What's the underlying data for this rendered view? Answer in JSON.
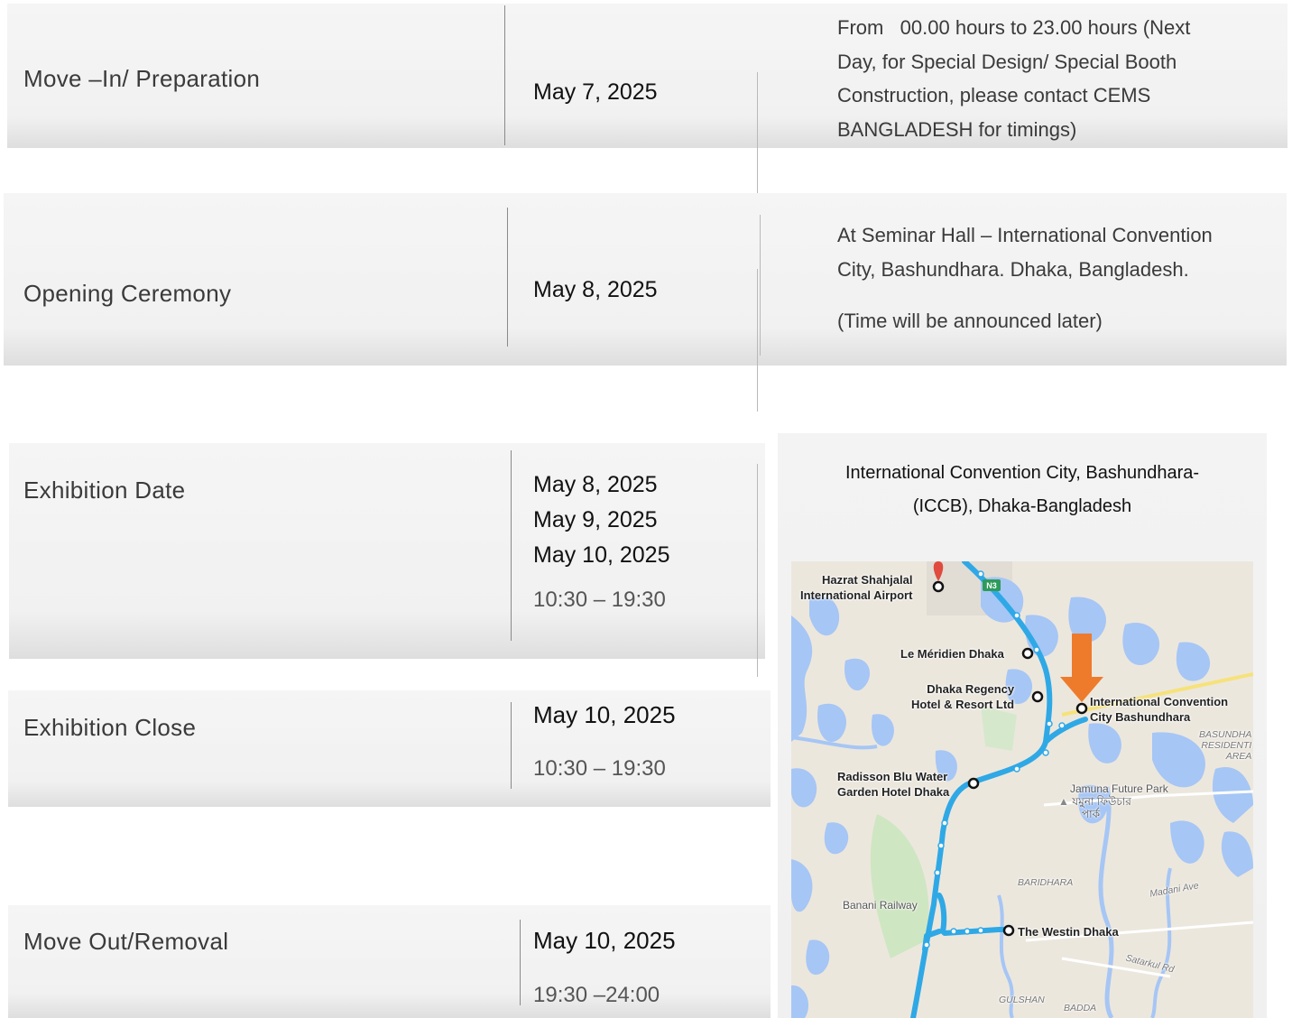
{
  "schedule": [
    {
      "label": "Move –In/ Preparation",
      "dates": [
        "May 7, 2025"
      ],
      "info_lines": [
        "From   00.00 hours to 23.00 hours (Next",
        "Day, for Special Design/ Special Booth",
        "Construction, please contact CEMS",
        "BANGLADESH for timings)"
      ]
    },
    {
      "label": "Opening Ceremony",
      "dates": [
        "May 8, 2025"
      ],
      "info_lines": [
        "At Seminar Hall – International Convention",
        "City, Bashundhara. Dhaka, Bangladesh."
      ],
      "info_note": "(Time will be announced later)"
    },
    {
      "label": "Exhibition Date",
      "dates": [
        "May 8, 2025",
        "May 9, 2025",
        "May 10, 2025"
      ],
      "time": "10:30 – 19:30"
    },
    {
      "label": "Exhibition Close",
      "dates": [
        "May 10, 2025"
      ],
      "time": "10:30 – 19:30"
    },
    {
      "label": "Move Out/Removal",
      "dates": [
        "May 10, 2025"
      ],
      "time": "19:30 –24:00"
    }
  ],
  "venue": {
    "title_line1": "International Convention City, Bashundhara-",
    "title_line2": "(ICCB), Dhaka-Bangladesh"
  },
  "map": {
    "labels": {
      "airport": [
        "Hazrat Shahjalal",
        "International Airport"
      ],
      "meridien": "Le Méridien Dhaka",
      "regency": [
        "Dhaka Regency",
        "Hotel & Resort Ltd"
      ],
      "iccb": [
        "International Convention",
        "City Bashundhara"
      ],
      "radisson": [
        "Radisson Blu Water",
        "Garden Hotel Dhaka"
      ],
      "jamuna": "Jamuna Future Park",
      "jamuna_bn": [
        "যমুনা ফিউচার",
        "পার্ক"
      ],
      "basundhara": [
        "BASUNDHA",
        "RESIDENTI",
        "AREA"
      ],
      "baridhara": "BARIDHARA",
      "banani": "Banani Railway",
      "westin": "The Westin Dhaka",
      "madani": "Madani Ave",
      "satarkul": "Satarkul Rd",
      "gulshan": "GULSHAN",
      "badda": "BADDA",
      "highway": "N3"
    },
    "colors": {
      "route": "#2fa8e6",
      "water": "#a6c6f5",
      "arrow": "#ee7b2c",
      "pin": "#e04a3f"
    }
  }
}
